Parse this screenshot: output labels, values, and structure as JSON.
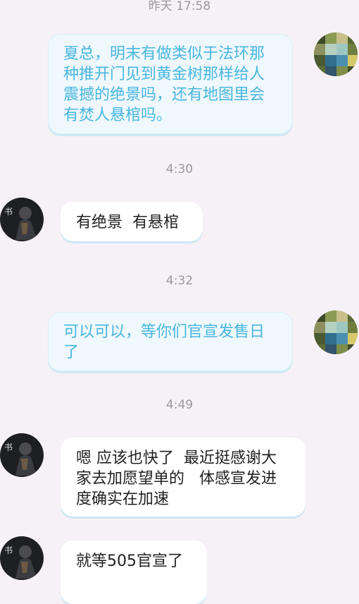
{
  "messages": {
    "ts_yesterday": "昨天 17:58",
    "m1": "夏总，明末有做类似于法环那种推开门见到黄金树那样给人震撼的绝景吗，还有地图里会有焚人悬棺吗。",
    "ts_430": "4:30",
    "m2": "有绝景  有悬棺",
    "ts_432": "4:32",
    "m3": "可以可以，等你们官宣发售日了",
    "ts_449": "4:49",
    "m4": "嗯 应该也快了  最近挺感谢大家去加愿望单的   体感宣发进度确实在加速",
    "m5": "就等505官宣了"
  },
  "colors": {
    "background": "#f6f1f6",
    "outgoing_bubble": "#eef8fd",
    "outgoing_text": "#49b6de",
    "incoming_bubble": "#ffffff",
    "incoming_text": "#222222",
    "timestamp": "#9a9a9a"
  },
  "icons": {
    "self_avatar": "pixelated-avatar-icon",
    "other_avatar": "warrior-avatar-icon"
  }
}
